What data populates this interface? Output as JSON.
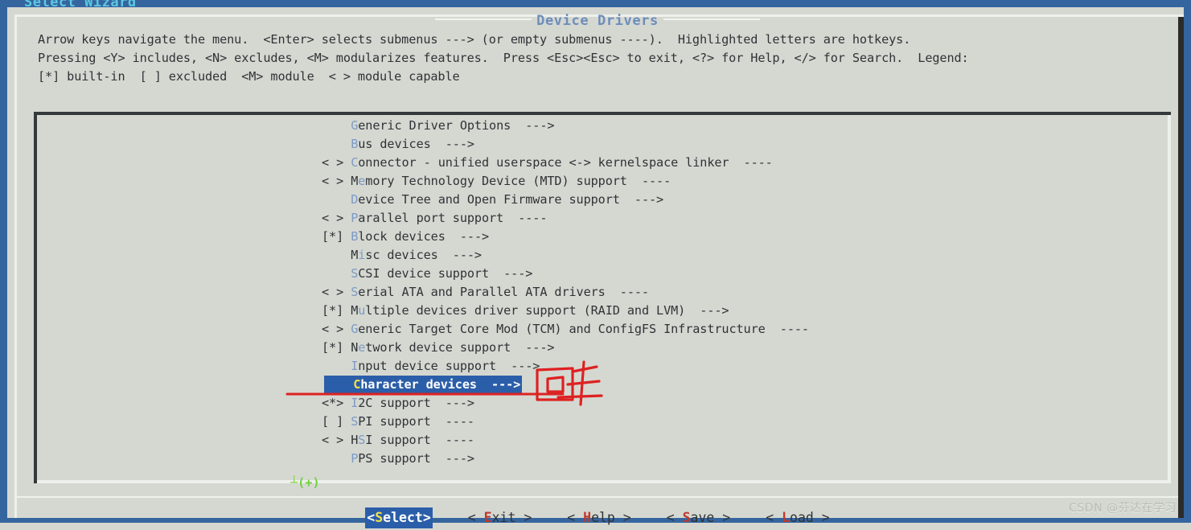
{
  "window": {
    "clipped_top_title": "Select Wizard",
    "title": "Device Drivers"
  },
  "help": {
    "line1": "Arrow keys navigate the menu.  <Enter> selects submenus ---> (or empty submenus ----).  Highlighted letters are hotkeys.",
    "line2": "Pressing <Y> includes, <N> excludes, <M> modularizes features.  Press <Esc><Esc> to exit, <?> for Help, </> for Search.  Legend:",
    "line3": "[*] built-in  [ ] excluded  <M> module  < > module capable"
  },
  "menu": {
    "items": [
      {
        "state": "",
        "hotkey": "G",
        "pre": "",
        "rest": "eneric Driver Options",
        "suffix": "  --->",
        "selected": false
      },
      {
        "state": "",
        "hotkey": "B",
        "pre": "",
        "rest": "us devices",
        "suffix": "  --->",
        "selected": false
      },
      {
        "state": "< >",
        "hotkey": "C",
        "pre": "",
        "rest": "onnector - unified userspace <-> kernelspace linker",
        "suffix": "  ----",
        "selected": false
      },
      {
        "state": "< >",
        "hotkey": "e",
        "pre": "M",
        "rest": "mory Technology Device (MTD) support",
        "suffix": "  ----",
        "selected": false
      },
      {
        "state": "",
        "hotkey": "D",
        "pre": "",
        "rest": "evice Tree and Open Firmware support",
        "suffix": "  --->",
        "selected": false
      },
      {
        "state": "< >",
        "hotkey": "P",
        "pre": "",
        "rest": "arallel port support",
        "suffix": "  ----",
        "selected": false
      },
      {
        "state": "[*]",
        "hotkey": "B",
        "pre": "",
        "rest": "lock devices",
        "suffix": "  --->",
        "selected": false
      },
      {
        "state": "",
        "hotkey": "i",
        "pre": "M",
        "rest": "sc devices",
        "suffix": "  --->",
        "selected": false
      },
      {
        "state": "",
        "hotkey": "S",
        "pre": "",
        "rest": "CSI device support",
        "suffix": "  --->",
        "selected": false
      },
      {
        "state": "< >",
        "hotkey": "S",
        "pre": "",
        "rest": "erial ATA and Parallel ATA drivers",
        "suffix": "  ----",
        "selected": false
      },
      {
        "state": "[*]",
        "hotkey": "u",
        "pre": "M",
        "rest": "ltiple devices driver support (RAID and LVM)",
        "suffix": "  --->",
        "selected": false
      },
      {
        "state": "< >",
        "hotkey": "G",
        "pre": "",
        "rest": "eneric Target Core Mod (TCM) and ConfigFS Infrastructure",
        "suffix": "  ----",
        "selected": false
      },
      {
        "state": "[*]",
        "hotkey": "e",
        "pre": "N",
        "rest": "twork device support",
        "suffix": "  --->",
        "selected": false
      },
      {
        "state": "",
        "hotkey": "I",
        "pre": "",
        "rest": "nput device support",
        "suffix": "  --->",
        "selected": false
      },
      {
        "state": "",
        "hotkey": "C",
        "pre": "",
        "rest": "haracter devices",
        "suffix": "  --->",
        "selected": true
      },
      {
        "state": "<*>",
        "hotkey": "I",
        "pre": "",
        "rest": "2C support",
        "suffix": "  --->",
        "selected": false
      },
      {
        "state": "[ ]",
        "hotkey": "S",
        "pre": "",
        "rest": "PI support",
        "suffix": "  ----",
        "selected": false
      },
      {
        "state": "< >",
        "hotkey": "S",
        "pre": "H",
        "rest": "I support",
        "suffix": "  ----",
        "selected": false
      },
      {
        "state": "",
        "hotkey": "P",
        "pre": "",
        "rest": "PS support",
        "suffix": "  --->",
        "selected": false
      }
    ],
    "scroll_indicator": "(+)"
  },
  "buttons": [
    {
      "label": "<Select>",
      "hotkey": "S",
      "before": "<",
      "after": "elect>",
      "active": true
    },
    {
      "label": "< Exit >",
      "hotkey": "E",
      "before": "< ",
      "after": "xit >",
      "active": false
    },
    {
      "label": "< Help >",
      "hotkey": "H",
      "before": "< ",
      "after": "elp >",
      "active": false
    },
    {
      "label": "< Save >",
      "hotkey": "S",
      "before": "< ",
      "after": "ave >",
      "active": false
    },
    {
      "label": "< Load >",
      "hotkey": "L",
      "before": "< ",
      "after": "oad >",
      "active": false
    }
  ],
  "annotation": {
    "text": "回车",
    "color": "#dd2222"
  },
  "watermark": "CSDN @芬达在学习",
  "colors": {
    "frame_blue": "#35659f",
    "panel_bg": "#d5d8d1",
    "title_blue": "#6e8dbb",
    "hotkey_blue": "#7d9ac6",
    "selection_bg": "#2b5ea8",
    "selection_hotkey": "#f2e34a",
    "button_hotkey_red": "#c0392b",
    "scroll_green": "#6fd13a",
    "text": "#2f3336"
  }
}
